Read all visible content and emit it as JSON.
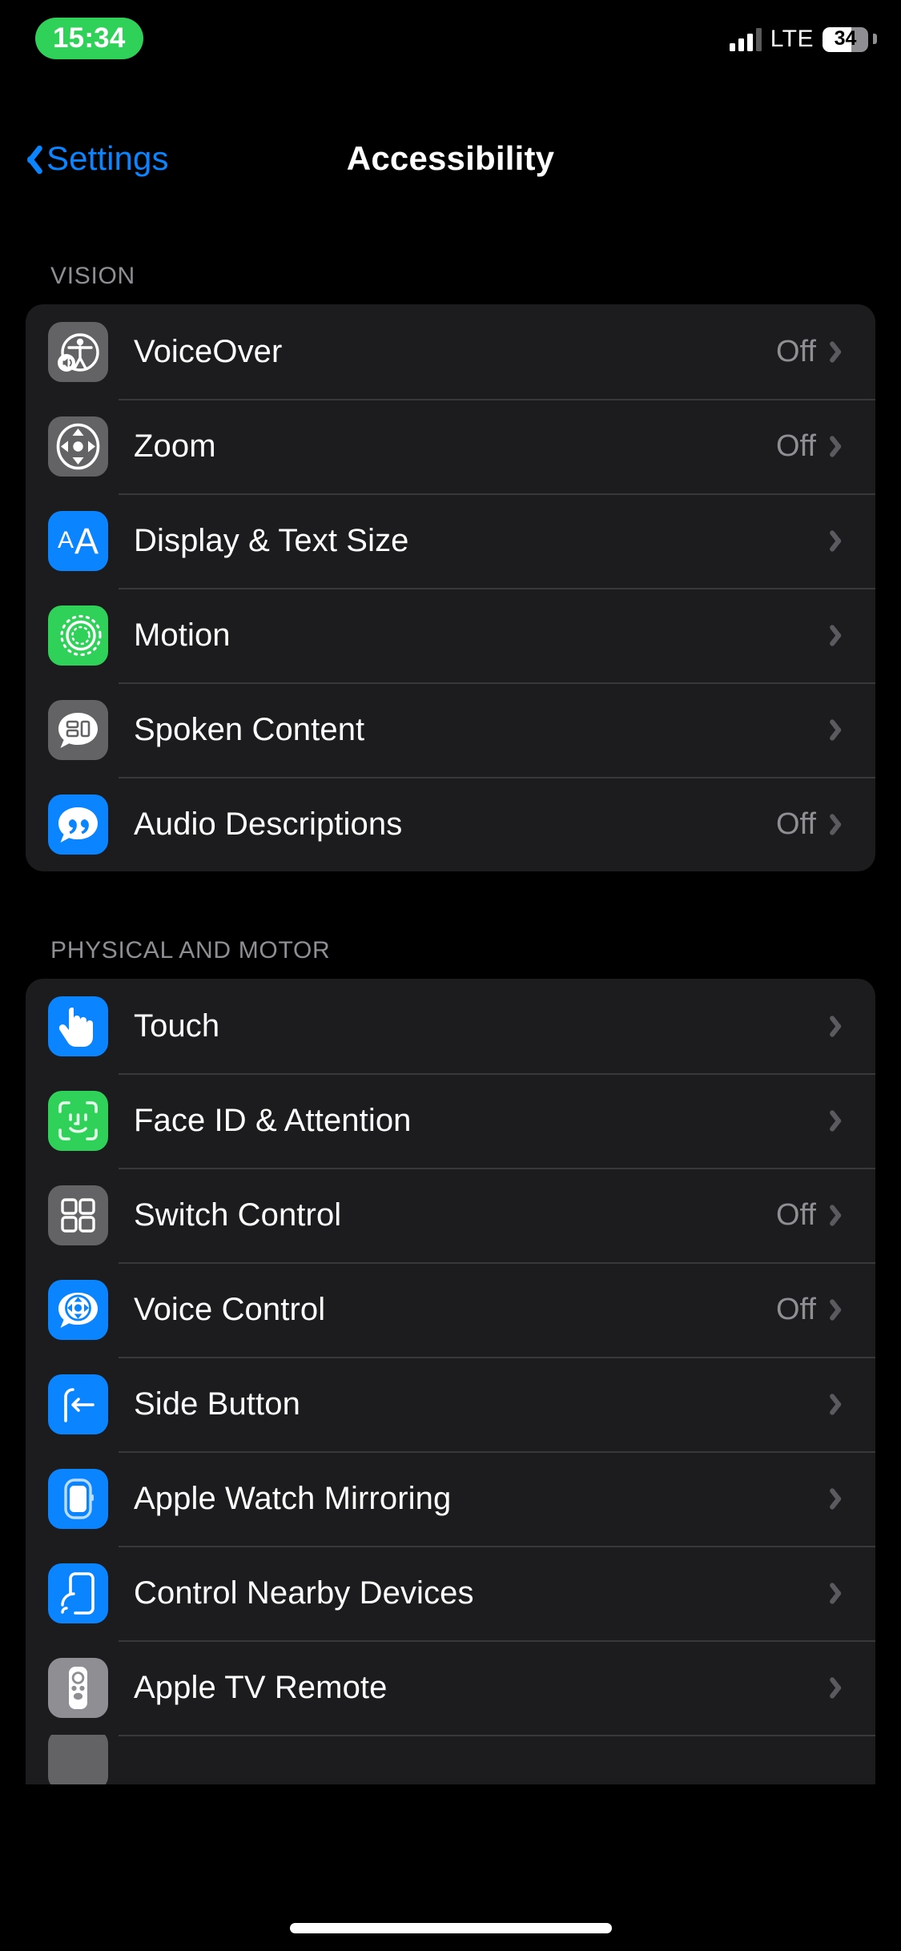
{
  "status_bar": {
    "time": "15:34",
    "time_pill_color": "#30D158",
    "carrier_tech": "LTE",
    "battery_percent": "34",
    "signal_bars": 3
  },
  "nav": {
    "back_label": "Settings",
    "title": "Accessibility",
    "accent_color": "#0a84ff"
  },
  "sections": [
    {
      "header": "VISION",
      "rows": [
        {
          "label": "VoiceOver",
          "value": "Off",
          "icon": "voiceover-icon",
          "icon_color": "#636366"
        },
        {
          "label": "Zoom",
          "value": "Off",
          "icon": "zoom-icon",
          "icon_color": "#636366"
        },
        {
          "label": "Display & Text Size",
          "value": "",
          "icon": "display-text-size-icon",
          "icon_color": "#0a84ff"
        },
        {
          "label": "Motion",
          "value": "",
          "icon": "motion-icon",
          "icon_color": "#30D158"
        },
        {
          "label": "Spoken Content",
          "value": "",
          "icon": "spoken-content-icon",
          "icon_color": "#636366"
        },
        {
          "label": "Audio Descriptions",
          "value": "Off",
          "icon": "audio-descriptions-icon",
          "icon_color": "#0a84ff"
        }
      ]
    },
    {
      "header": "PHYSICAL AND MOTOR",
      "rows": [
        {
          "label": "Touch",
          "value": "",
          "icon": "touch-icon",
          "icon_color": "#0a84ff"
        },
        {
          "label": "Face ID & Attention",
          "value": "",
          "icon": "face-id-icon",
          "icon_color": "#30D158"
        },
        {
          "label": "Switch Control",
          "value": "Off",
          "icon": "switch-control-icon",
          "icon_color": "#636366"
        },
        {
          "label": "Voice Control",
          "value": "Off",
          "icon": "voice-control-icon",
          "icon_color": "#0a84ff"
        },
        {
          "label": "Side Button",
          "value": "",
          "icon": "side-button-icon",
          "icon_color": "#0a84ff"
        },
        {
          "label": "Apple Watch Mirroring",
          "value": "",
          "icon": "apple-watch-mirroring-icon",
          "icon_color": "#0a84ff"
        },
        {
          "label": "Control Nearby Devices",
          "value": "",
          "icon": "control-nearby-devices-icon",
          "icon_color": "#0a84ff"
        },
        {
          "label": "Apple TV Remote",
          "value": "",
          "icon": "apple-tv-remote-icon",
          "icon_color": "#8e8e93"
        },
        {
          "label": "",
          "value": "",
          "icon": "partial-row-icon",
          "icon_color": "#636366"
        }
      ]
    }
  ],
  "theme": {
    "background": "#000000",
    "group_background": "#1c1c1e",
    "separator": "#38383a",
    "secondary_text": "#8e8e93",
    "primary_text": "#ffffff"
  }
}
